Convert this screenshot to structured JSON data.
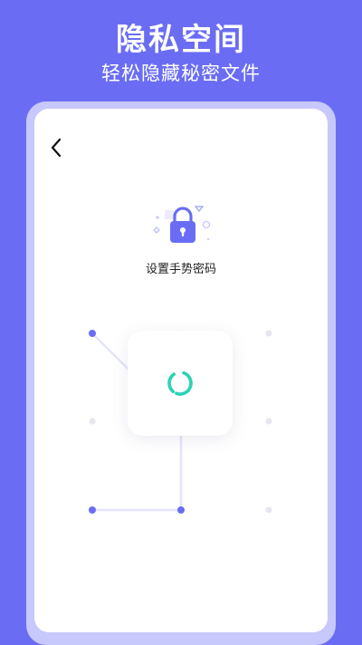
{
  "promo": {
    "title": "隐私空间",
    "subtitle": "轻松隐藏秘密文件"
  },
  "screen": {
    "back_icon": "chevron-left-icon",
    "lock_icon": "lock-icon",
    "gesture_prompt": "设置手势密码",
    "pattern": {
      "grid": "3x3",
      "selected_dots": [
        "top-left",
        "center",
        "bottom-center",
        "bottom-left"
      ]
    },
    "loading_icon": "loading-spinner-icon"
  },
  "colors": {
    "background": "#6a6df3",
    "frame": "#c7c8fb",
    "accent": "#6a6df3",
    "spinner": "#2ad3b3",
    "inactive_dot": "#e6e6ee"
  }
}
